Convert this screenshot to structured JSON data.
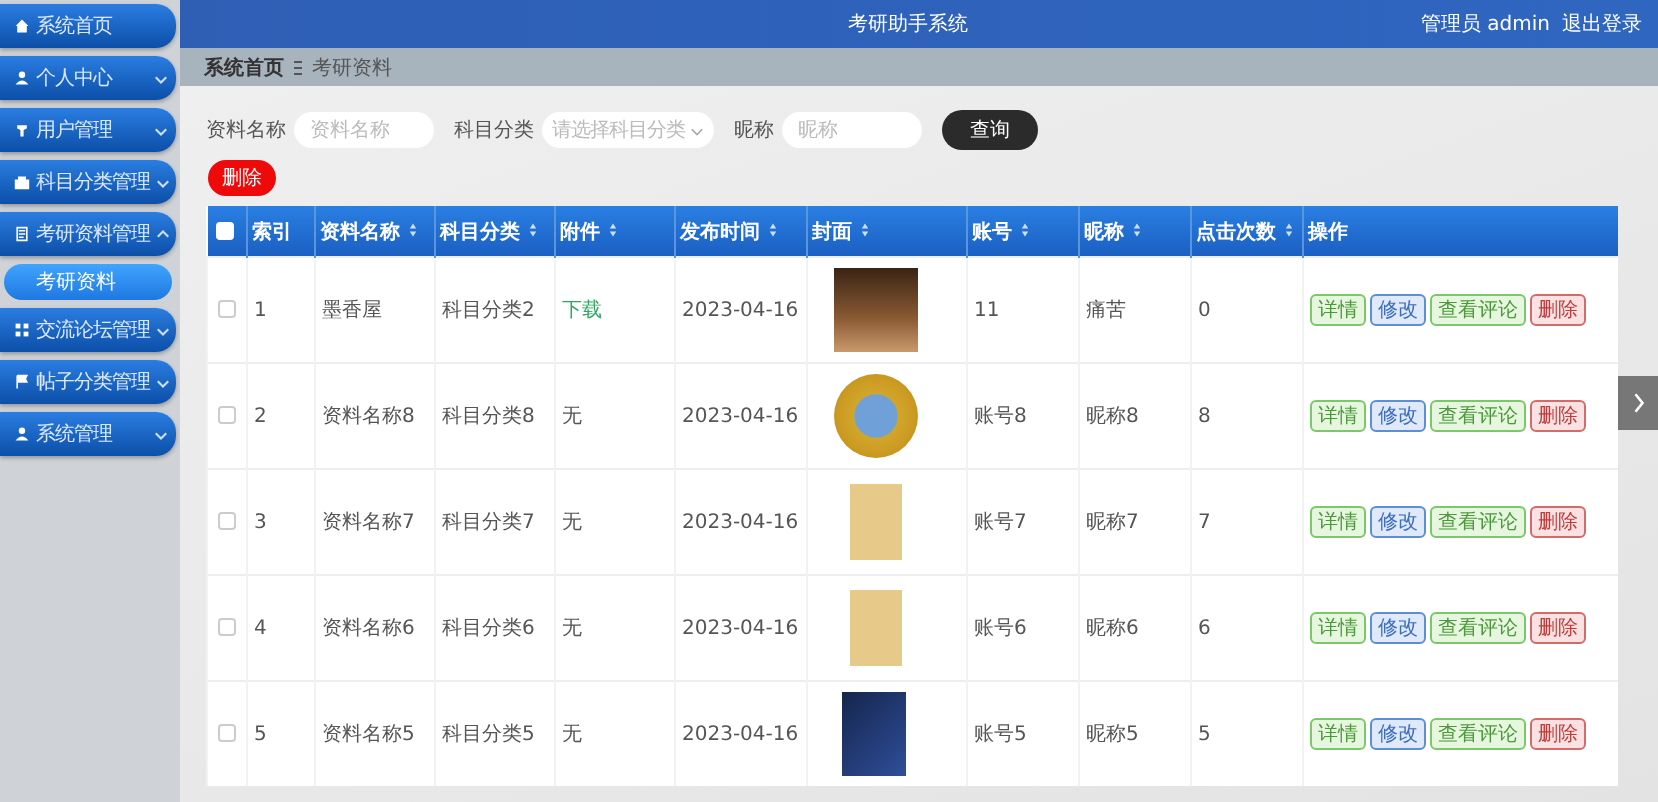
{
  "header": {
    "title": "考研助手系统",
    "user": "管理员 admin",
    "logout": "退出登录"
  },
  "sidebar": {
    "items": [
      {
        "label": "系统首页"
      },
      {
        "label": "个人中心",
        "expanded": false
      },
      {
        "label": "用户管理",
        "expanded": false
      },
      {
        "label": "科目分类管理",
        "expanded": false
      },
      {
        "label": "考研资料管理",
        "expanded": true,
        "children": [
          {
            "label": "考研资料",
            "selected": true
          }
        ]
      },
      {
        "label": "交流论坛管理",
        "expanded": false
      },
      {
        "label": "帖子分类管理",
        "expanded": false
      },
      {
        "label": "系统管理",
        "expanded": false
      }
    ]
  },
  "breadcrumb": [
    "系统首页",
    "考研资料"
  ],
  "search": {
    "fields": [
      {
        "label": "资料名称",
        "placeholder": "资料名称",
        "kind": "input"
      },
      {
        "label": "科目分类",
        "placeholder": "请选择科目分类",
        "kind": "select"
      },
      {
        "label": "昵称",
        "placeholder": "昵称",
        "kind": "input"
      }
    ],
    "query_button": "查询",
    "delete_button": "删除"
  },
  "table": {
    "header_checked": false,
    "columns": [
      {
        "label": "索引",
        "sortable": false
      },
      {
        "label": "资料名称",
        "sortable": true
      },
      {
        "label": "科目分类",
        "sortable": true
      },
      {
        "label": "附件",
        "sortable": true
      },
      {
        "label": "发布时间",
        "sortable": true
      },
      {
        "label": "封面",
        "sortable": true
      },
      {
        "label": "账号",
        "sortable": true
      },
      {
        "label": "昵称",
        "sortable": true
      },
      {
        "label": "点击次数",
        "sortable": true
      },
      {
        "label": "操作",
        "sortable": false
      }
    ],
    "rows": [
      {
        "checked": false,
        "index": "1",
        "name": "墨香屋",
        "category": "科目分类2",
        "attachment": "下载",
        "attachment_link": true,
        "date": "2023-04-16",
        "account": "11",
        "nickname": "痛苦",
        "clicks": "0",
        "actions": [
          "详情",
          "修改",
          "查看评论",
          "删除"
        ]
      },
      {
        "checked": false,
        "index": "2",
        "name": "资料名称8",
        "category": "科目分类8",
        "attachment": "无",
        "attachment_link": false,
        "date": "2023-04-16",
        "account": "账号8",
        "nickname": "昵称8",
        "clicks": "8",
        "actions": [
          "详情",
          "修改",
          "查看评论",
          "删除"
        ]
      },
      {
        "checked": false,
        "index": "3",
        "name": "资料名称7",
        "category": "科目分类7",
        "attachment": "无",
        "attachment_link": false,
        "date": "2023-04-16",
        "account": "账号7",
        "nickname": "昵称7",
        "clicks": "7",
        "actions": [
          "详情",
          "修改",
          "查看评论",
          "删除"
        ]
      },
      {
        "checked": false,
        "index": "4",
        "name": "资料名称6",
        "category": "科目分类6",
        "attachment": "无",
        "attachment_link": false,
        "date": "2023-04-16",
        "account": "账号6",
        "nickname": "昵称6",
        "clicks": "6",
        "actions": [
          "详情",
          "修改",
          "查看评论",
          "删除"
        ]
      },
      {
        "checked": false,
        "index": "5",
        "name": "资料名称5",
        "category": "科目分类5",
        "attachment": "无",
        "attachment_link": false,
        "date": "2023-04-16",
        "account": "账号5",
        "nickname": "昵称5",
        "clicks": "5",
        "actions": [
          "详情",
          "修改",
          "查看评论",
          "删除"
        ]
      }
    ]
  }
}
